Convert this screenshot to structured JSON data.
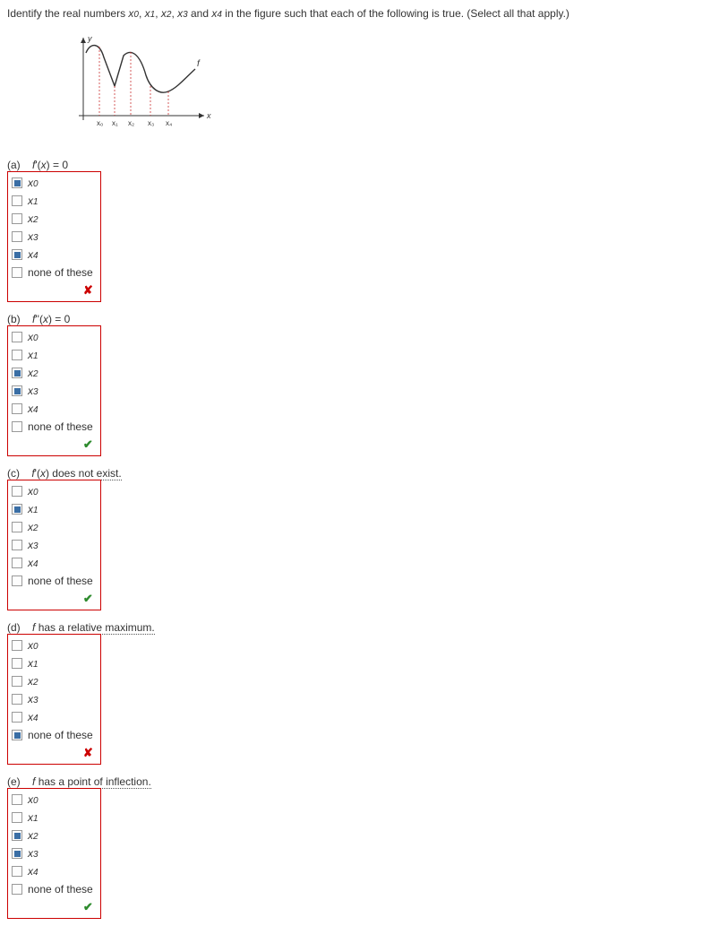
{
  "prompt_prefix": "Identify the real numbers ",
  "prompt_vars": [
    "x",
    "0",
    ", ",
    "x",
    "1",
    ", ",
    "x",
    "2",
    ", ",
    "x",
    "3",
    " and ",
    "x",
    "4"
  ],
  "prompt_suffix": " in the figure such that each of the following is true. (Select all that apply.)",
  "chart_data": {
    "type": "line",
    "xlabel": "x",
    "ylabel": "y",
    "curve_label": "f",
    "x_ticks": [
      "x₀",
      "x₁",
      "x₂",
      "x₃",
      "x₄"
    ],
    "description": "Function curve with cusp at x1, local max at x0, inflection behavior around x2 and x3, endpoint at x4"
  },
  "options_labels": {
    "x0": "x",
    "x0_sub": "0",
    "x1": "x",
    "x1_sub": "1",
    "x2": "x",
    "x2_sub": "2",
    "x3": "x",
    "x3_sub": "3",
    "x4": "x",
    "x4_sub": "4",
    "none": "none of these"
  },
  "questions": [
    {
      "label_part": "(a)",
      "cond_pre": "f",
      "cond_prime": "'(",
      "cond_var": "x",
      "cond_post": ") = 0",
      "checked": [
        "x0",
        "x4"
      ],
      "feedback": "incorrect"
    },
    {
      "label_part": "(b)",
      "cond_pre": "f",
      "cond_prime": "''(",
      "cond_var": "x",
      "cond_post": ") = 0",
      "checked": [
        "x2",
        "x3"
      ],
      "feedback": "correct"
    },
    {
      "label_part": "(c)",
      "cond_pre": "f",
      "cond_prime": "'(",
      "cond_var": "x",
      "cond_post": ") does not exist.",
      "checked": [
        "x1"
      ],
      "feedback": "correct"
    },
    {
      "label_part": "(d)",
      "cond_plain_pre": "f",
      "cond_plain_post": " has a relative maximum.",
      "checked": [
        "none"
      ],
      "feedback": "incorrect"
    },
    {
      "label_part": "(e)",
      "cond_plain_pre": "f",
      "cond_plain_post": " has a point of inflection.",
      "checked": [
        "x2",
        "x3"
      ],
      "feedback": "correct"
    }
  ],
  "feedback_marks": {
    "correct": "✔",
    "incorrect": "✘"
  }
}
